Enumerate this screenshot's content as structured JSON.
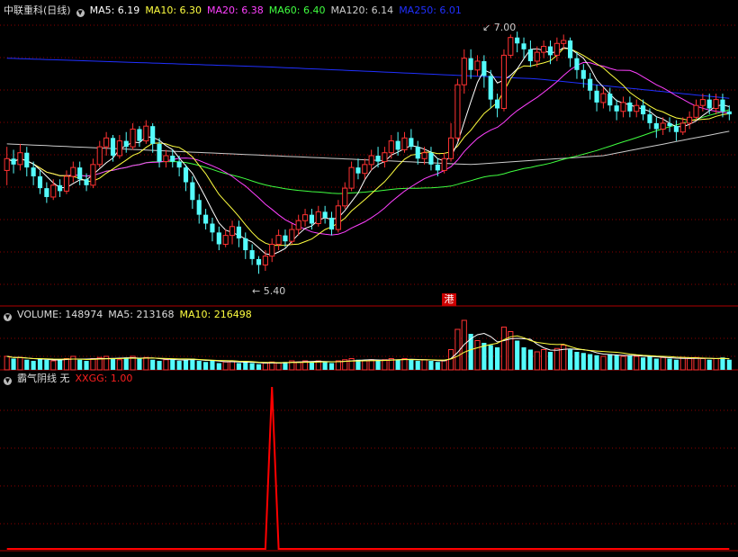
{
  "header": {
    "title": "中联重科(日线)",
    "ma": [
      {
        "label": "MA5: 6.19",
        "color": "#ffffff"
      },
      {
        "label": "MA10: 6.30",
        "color": "#ffff40"
      },
      {
        "label": "MA20: 6.38",
        "color": "#ff40ff"
      },
      {
        "label": "MA60: 6.40",
        "color": "#40ff40"
      },
      {
        "label": "MA120: 6.14",
        "color": "#cccccc"
      },
      {
        "label": "MA250: 6.01",
        "color": "#2030ff"
      }
    ]
  },
  "volume_header": {
    "volume": "VOLUME: 148974",
    "ma5": "MA5: 213168",
    "ma10": "MA10: 216498"
  },
  "indicator_header": {
    "name": "霸气阴线 无",
    "value": "XXGG: 1.00"
  },
  "annotations": {
    "high": "7.00",
    "low": "5.40",
    "marker": "港"
  },
  "colors": {
    "up": "#ff3232",
    "down": "#54fcfc",
    "grid": "#8b0000",
    "signal": "#ff0000"
  },
  "chart_data": {
    "type": "candlestick",
    "price_range": [
      5.28,
      7.12
    ],
    "candles": [
      [
        6.1,
        6.18,
        6.26,
        6.0
      ],
      [
        6.18,
        6.14,
        6.24,
        6.08
      ],
      [
        6.14,
        6.22,
        6.28,
        6.1
      ],
      [
        6.22,
        6.12,
        6.26,
        6.06
      ],
      [
        6.12,
        6.06,
        6.16,
        6.0
      ],
      [
        6.06,
        5.98,
        6.1,
        5.94
      ],
      [
        5.98,
        5.92,
        6.02,
        5.88
      ],
      [
        5.92,
        6.0,
        6.04,
        5.9
      ],
      [
        6.0,
        5.96,
        6.04,
        5.92
      ],
      [
        5.96,
        6.06,
        6.1,
        5.94
      ],
      [
        6.06,
        6.12,
        6.16,
        6.02
      ],
      [
        6.12,
        6.04,
        6.16,
        6.0
      ],
      [
        6.04,
        6.0,
        6.08,
        5.96
      ],
      [
        6.0,
        6.14,
        6.18,
        5.98
      ],
      [
        6.14,
        6.26,
        6.3,
        6.12
      ],
      [
        6.26,
        6.32,
        6.36,
        6.2
      ],
      [
        6.32,
        6.2,
        6.34,
        6.16
      ],
      [
        6.2,
        6.3,
        6.34,
        6.18
      ],
      [
        6.3,
        6.26,
        6.36,
        6.22
      ],
      [
        6.26,
        6.38,
        6.42,
        6.24
      ],
      [
        6.38,
        6.3,
        6.4,
        6.26
      ],
      [
        6.3,
        6.4,
        6.44,
        6.28
      ],
      [
        6.4,
        6.28,
        6.42,
        6.22
      ],
      [
        6.28,
        6.16,
        6.32,
        6.12
      ],
      [
        6.16,
        6.2,
        6.24,
        6.12
      ],
      [
        6.2,
        6.16,
        6.24,
        6.12
      ],
      [
        6.16,
        6.12,
        6.2,
        6.06
      ],
      [
        6.12,
        6.02,
        6.14,
        5.96
      ],
      [
        6.02,
        5.9,
        6.06,
        5.84
      ],
      [
        5.9,
        5.8,
        5.94,
        5.74
      ],
      [
        5.8,
        5.74,
        5.84,
        5.7
      ],
      [
        5.74,
        5.68,
        5.78,
        5.62
      ],
      [
        5.68,
        5.6,
        5.72,
        5.56
      ],
      [
        5.6,
        5.66,
        5.7,
        5.58
      ],
      [
        5.66,
        5.72,
        5.76,
        5.6
      ],
      [
        5.72,
        5.64,
        5.76,
        5.58
      ],
      [
        5.64,
        5.56,
        5.68,
        5.5
      ],
      [
        5.56,
        5.5,
        5.6,
        5.46
      ],
      [
        5.5,
        5.46,
        5.52,
        5.4
      ],
      [
        5.46,
        5.52,
        5.56,
        5.42
      ],
      [
        5.52,
        5.6,
        5.64,
        5.48
      ],
      [
        5.6,
        5.66,
        5.7,
        5.56
      ],
      [
        5.66,
        5.62,
        5.7,
        5.58
      ],
      [
        5.62,
        5.7,
        5.74,
        5.6
      ],
      [
        5.7,
        5.76,
        5.8,
        5.66
      ],
      [
        5.76,
        5.8,
        5.84,
        5.72
      ],
      [
        5.8,
        5.74,
        5.84,
        5.7
      ],
      [
        5.74,
        5.82,
        5.86,
        5.72
      ],
      [
        5.82,
        5.78,
        5.86,
        5.74
      ],
      [
        5.78,
        5.7,
        5.82,
        5.66
      ],
      [
        5.7,
        5.86,
        5.9,
        5.68
      ],
      [
        5.86,
        5.98,
        6.02,
        5.84
      ],
      [
        5.98,
        6.12,
        6.16,
        5.96
      ],
      [
        6.12,
        6.08,
        6.18,
        6.04
      ],
      [
        6.08,
        6.14,
        6.18,
        6.04
      ],
      [
        6.14,
        6.2,
        6.24,
        6.1
      ],
      [
        6.2,
        6.16,
        6.26,
        6.12
      ],
      [
        6.16,
        6.22,
        6.26,
        6.12
      ],
      [
        6.22,
        6.3,
        6.34,
        6.18
      ],
      [
        6.3,
        6.24,
        6.36,
        6.2
      ],
      [
        6.24,
        6.32,
        6.36,
        6.22
      ],
      [
        6.32,
        6.26,
        6.38,
        6.24
      ],
      [
        6.26,
        6.18,
        6.3,
        6.14
      ],
      [
        6.18,
        6.22,
        6.26,
        6.14
      ],
      [
        6.22,
        6.14,
        6.26,
        6.1
      ],
      [
        6.14,
        6.1,
        6.18,
        6.06
      ],
      [
        6.1,
        6.18,
        6.22,
        6.08
      ],
      [
        6.18,
        6.32,
        6.42,
        6.16
      ],
      [
        6.32,
        6.68,
        6.72,
        6.3
      ],
      [
        6.68,
        6.86,
        6.92,
        6.62
      ],
      [
        6.86,
        6.78,
        6.92,
        6.72
      ],
      [
        6.78,
        6.84,
        6.88,
        6.74
      ],
      [
        6.84,
        6.74,
        6.88,
        6.66
      ],
      [
        6.74,
        6.58,
        6.78,
        6.52
      ],
      [
        6.58,
        6.52,
        6.62,
        6.46
      ],
      [
        6.52,
        6.88,
        6.92,
        6.5
      ],
      [
        6.88,
        7.0,
        7.02,
        6.86
      ],
      [
        7.0,
        6.96,
        7.04,
        6.9
      ],
      [
        6.96,
        6.92,
        7.0,
        6.86
      ],
      [
        6.92,
        6.84,
        6.98,
        6.8
      ],
      [
        6.84,
        6.9,
        6.94,
        6.8
      ],
      [
        6.9,
        6.94,
        6.98,
        6.86
      ],
      [
        6.94,
        6.88,
        6.98,
        6.82
      ],
      [
        6.88,
        6.96,
        7.0,
        6.84
      ],
      [
        6.96,
        6.98,
        7.02,
        6.92
      ],
      [
        6.98,
        6.86,
        7.0,
        6.8
      ],
      [
        6.86,
        6.78,
        6.9,
        6.72
      ],
      [
        6.78,
        6.72,
        6.82,
        6.66
      ],
      [
        6.72,
        6.64,
        6.76,
        6.58
      ],
      [
        6.64,
        6.56,
        6.68,
        6.5
      ],
      [
        6.56,
        6.62,
        6.66,
        6.52
      ],
      [
        6.62,
        6.54,
        6.66,
        6.5
      ],
      [
        6.54,
        6.5,
        6.58,
        6.44
      ],
      [
        6.5,
        6.56,
        6.6,
        6.46
      ],
      [
        6.56,
        6.5,
        6.6,
        6.46
      ],
      [
        6.5,
        6.54,
        6.58,
        6.46
      ],
      [
        6.54,
        6.48,
        6.58,
        6.44
      ],
      [
        6.48,
        6.42,
        6.52,
        6.38
      ],
      [
        6.42,
        6.38,
        6.46,
        6.32
      ],
      [
        6.38,
        6.42,
        6.46,
        6.34
      ],
      [
        6.42,
        6.4,
        6.46,
        6.36
      ],
      [
        6.4,
        6.36,
        6.44,
        6.3
      ],
      [
        6.36,
        6.42,
        6.46,
        6.34
      ],
      [
        6.42,
        6.46,
        6.5,
        6.38
      ],
      [
        6.46,
        6.54,
        6.58,
        6.44
      ],
      [
        6.54,
        6.58,
        6.62,
        6.5
      ],
      [
        6.58,
        6.52,
        6.62,
        6.48
      ],
      [
        6.52,
        6.58,
        6.62,
        6.48
      ],
      [
        6.58,
        6.5,
        6.62,
        6.46
      ],
      [
        6.5,
        6.48,
        6.54,
        6.44
      ]
    ],
    "volume": [
      1.2,
      1.0,
      1.1,
      0.9,
      0.8,
      1.0,
      0.9,
      0.8,
      0.9,
      1.0,
      1.2,
      0.9,
      0.8,
      1.0,
      1.1,
      1.2,
      1.0,
      0.9,
      1.1,
      1.2,
      1.0,
      1.1,
      0.9,
      0.8,
      0.9,
      1.0,
      0.8,
      0.9,
      1.0,
      0.8,
      0.7,
      0.8,
      0.6,
      0.7,
      0.8,
      0.6,
      0.7,
      0.6,
      0.5,
      0.6,
      0.7,
      0.6,
      0.7,
      0.8,
      0.7,
      0.8,
      0.7,
      0.8,
      0.7,
      0.6,
      0.8,
      0.9,
      1.0,
      0.9,
      0.8,
      0.9,
      0.8,
      0.9,
      1.0,
      0.9,
      1.0,
      0.9,
      0.8,
      0.9,
      0.8,
      0.7,
      0.8,
      1.8,
      3.6,
      4.4,
      3.2,
      2.6,
      2.4,
      2.2,
      2.0,
      3.8,
      3.4,
      2.6,
      2.0,
      1.8,
      1.6,
      1.8,
      1.6,
      1.9,
      2.2,
      1.8,
      1.6,
      1.5,
      1.4,
      1.3,
      1.2,
      1.4,
      1.3,
      1.2,
      1.3,
      1.2,
      1.1,
      1.2,
      1.0,
      1.1,
      1.0,
      0.9,
      1.1,
      1.0,
      1.1,
      1.0,
      0.9,
      1.0,
      1.1,
      0.9
    ],
    "ma250_line": [
      [
        0,
        6.86
      ],
      [
        40,
        6.8
      ],
      [
        80,
        6.72
      ],
      [
        113,
        6.57
      ]
    ],
    "ma120_line": [
      [
        0,
        6.28
      ],
      [
        40,
        6.2
      ],
      [
        70,
        6.14
      ],
      [
        90,
        6.2
      ],
      [
        113,
        6.4
      ]
    ],
    "indicator": {
      "spike_index": 40,
      "range": [
        0,
        1
      ]
    }
  }
}
